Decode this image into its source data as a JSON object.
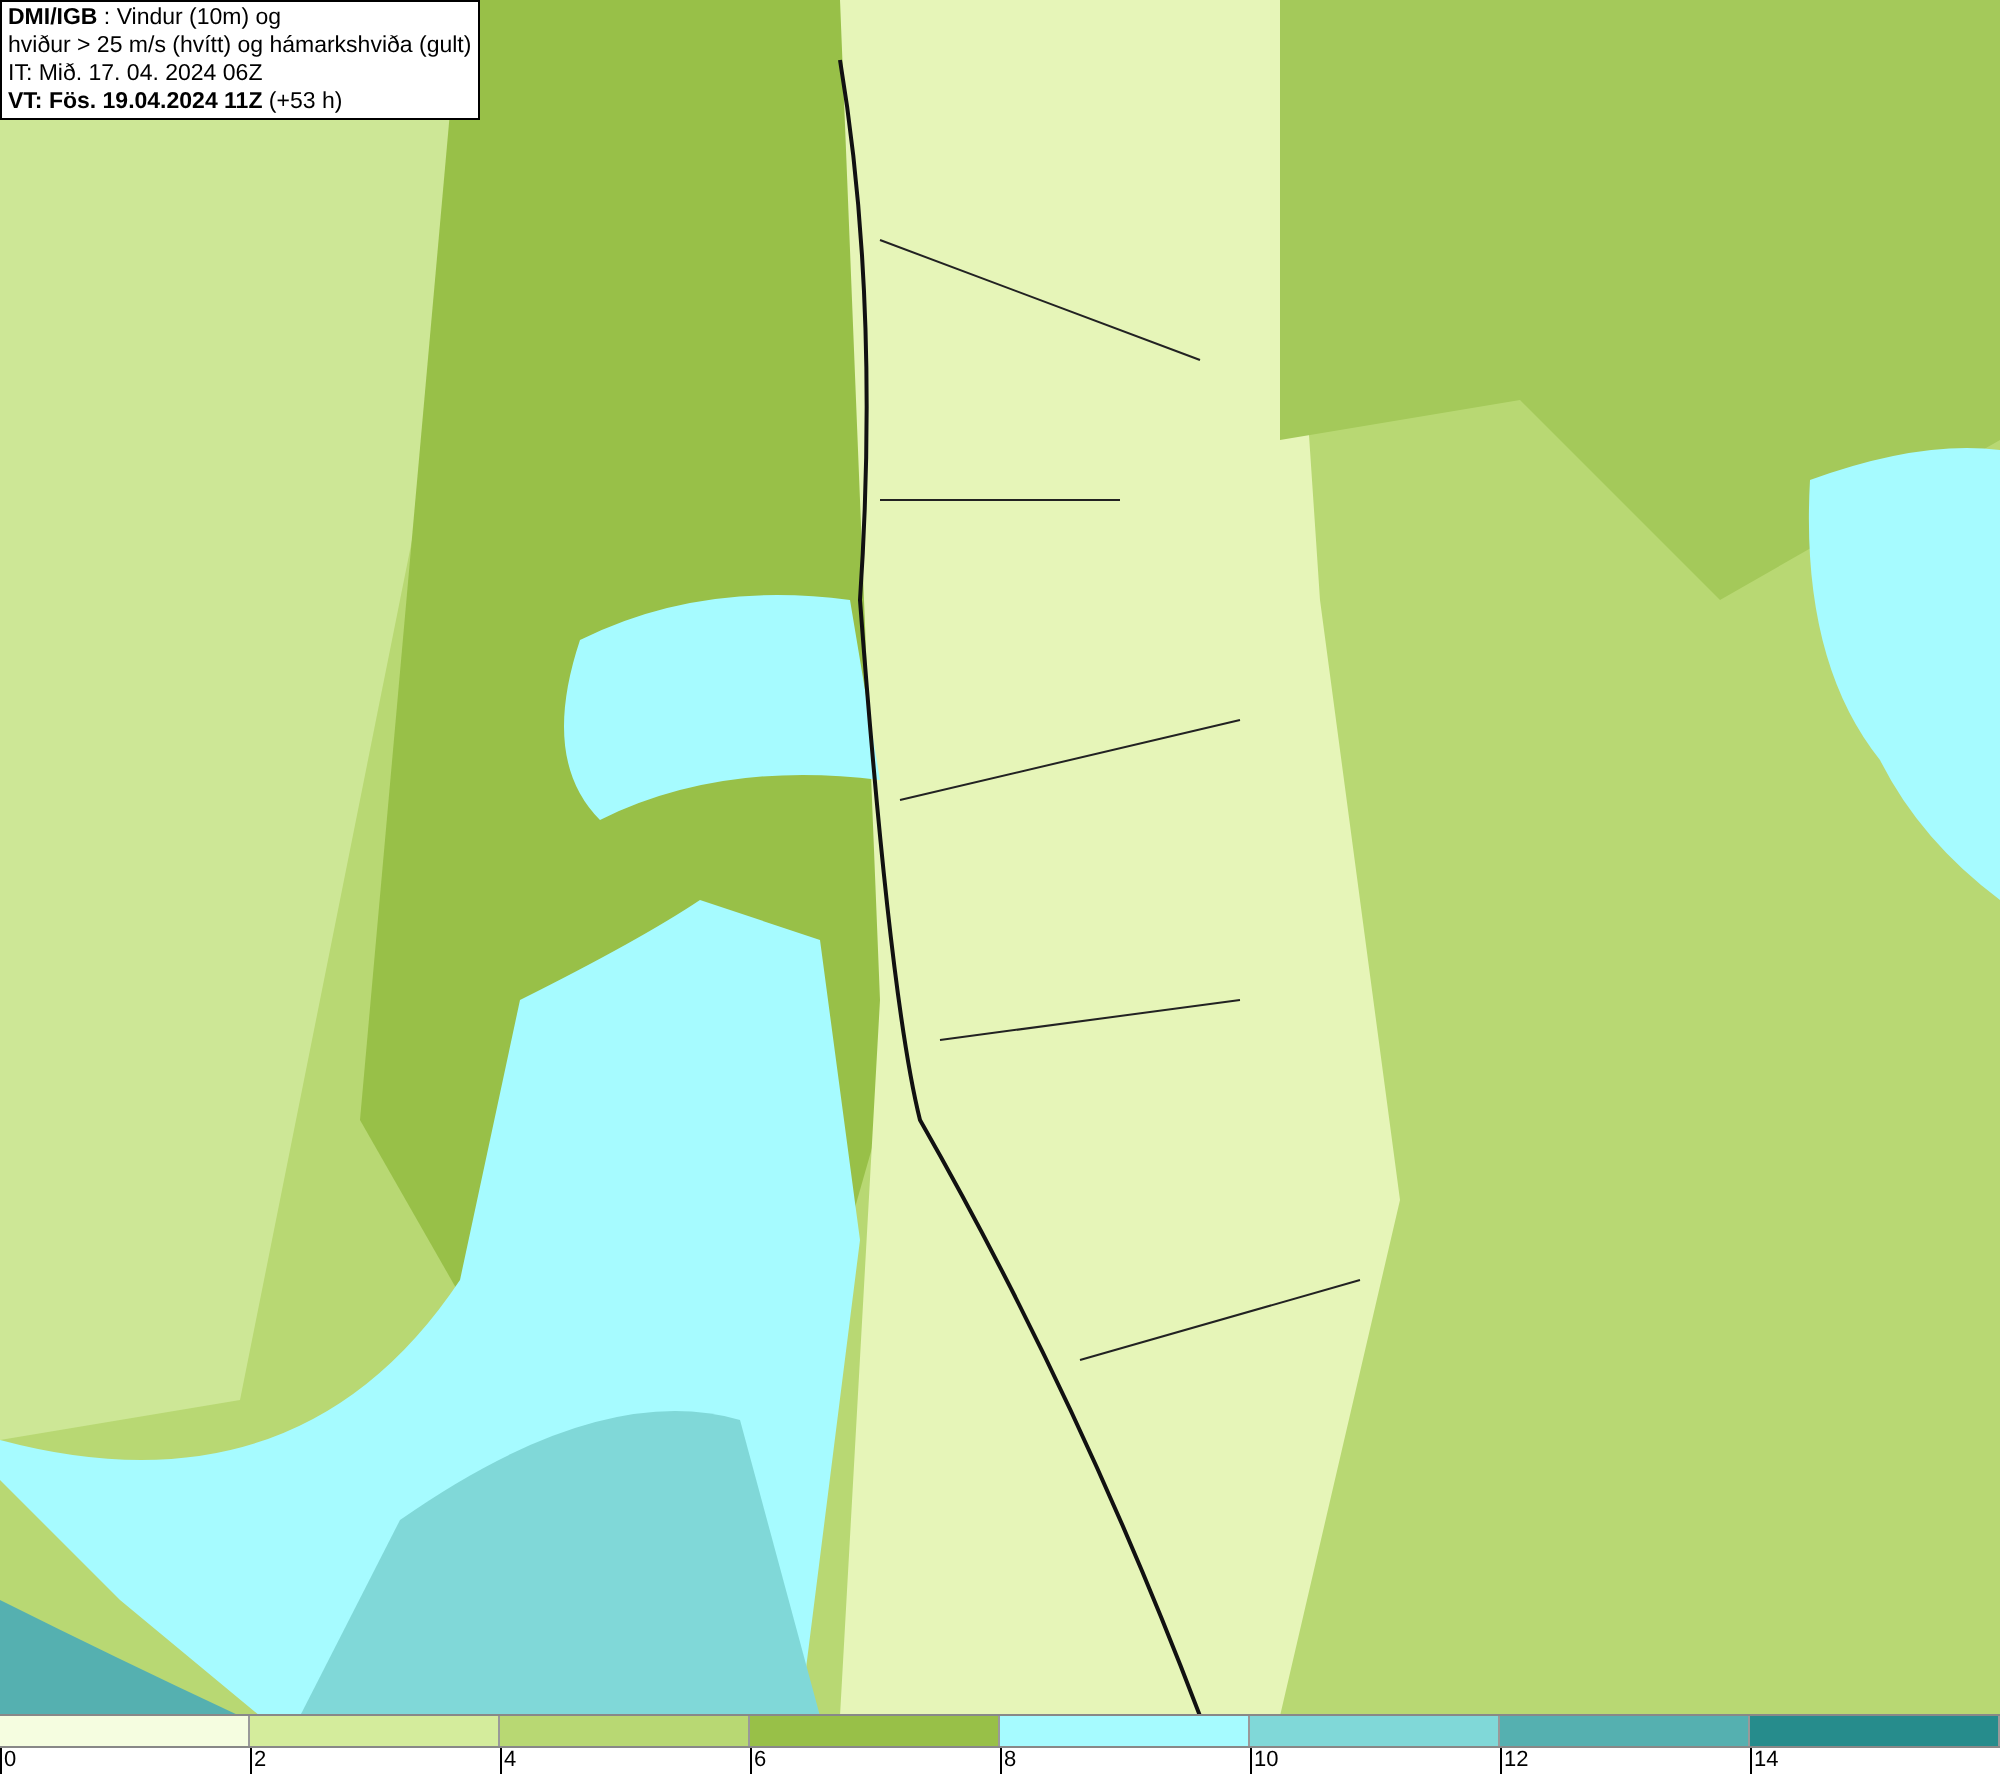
{
  "title_box": {
    "lines": [
      "**DMI/IGB** : Vindur (10m) og",
      "hviður > 25 m/s (hvítt) og hámarkshviða (gult)",
      "IT: Mið. 17. 04. 2024 06Z",
      "**VT: Fös. 19.04.2024 11Z** (+53 h)"
    ]
  },
  "legend": {
    "bins": [
      {
        "label": "0",
        "color": "#f5fde0"
      },
      {
        "label": "2",
        "color": "#d4ec9c"
      },
      {
        "label": "4",
        "color": "#b8d873"
      },
      {
        "label": "6",
        "color": "#98c048"
      },
      {
        "label": "8",
        "color": "#a6fbff"
      },
      {
        "label": "10",
        "color": "#80d8d8"
      },
      {
        "label": "12",
        "color": "#55b0b0"
      },
      {
        "label": "14",
        "color": "#268c8c"
      }
    ]
  }
}
